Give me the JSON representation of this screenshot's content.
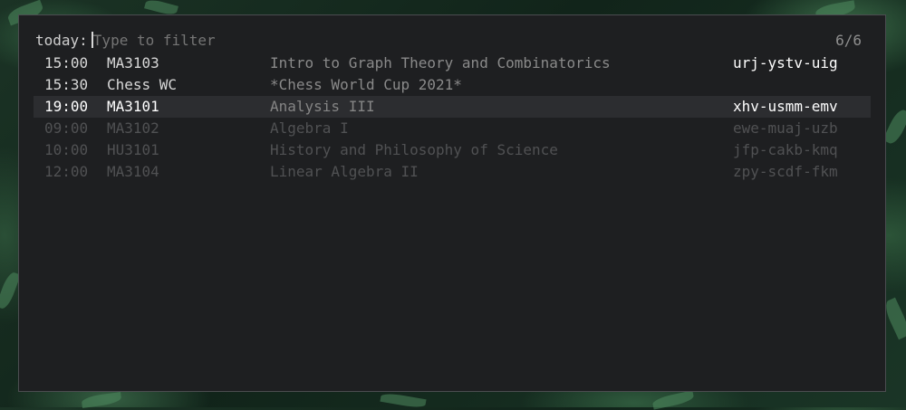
{
  "prompt": {
    "label": "today:",
    "placeholder": "Type to filter",
    "counter": "6/6"
  },
  "rows": [
    {
      "time": "15:00",
      "code": "MA3103",
      "title": "Intro to Graph Theory and Combinatorics",
      "link": "urj-ystv-uig",
      "state": "normal"
    },
    {
      "time": "15:30",
      "code": "Chess WC",
      "title": "*Chess World Cup 2021*",
      "link": "",
      "state": "normal"
    },
    {
      "time": "19:00",
      "code": "MA3101",
      "title": "Analysis III",
      "link": "xhv-usmm-emv",
      "state": "selected"
    },
    {
      "time": "09:00",
      "code": "MA3102",
      "title": "Algebra I",
      "link": "ewe-muaj-uzb",
      "state": "past"
    },
    {
      "time": "10:00",
      "code": "HU3101",
      "title": "History and Philosophy of Science",
      "link": "jfp-cakb-kmq",
      "state": "past"
    },
    {
      "time": "12:00",
      "code": "MA3104",
      "title": "Linear Algebra II",
      "link": "zpy-scdf-fkm",
      "state": "past"
    }
  ],
  "colors": {
    "window_bg": "#1e1f21",
    "selected_row_bg": "#2c2d30",
    "past_text": "#505153"
  }
}
